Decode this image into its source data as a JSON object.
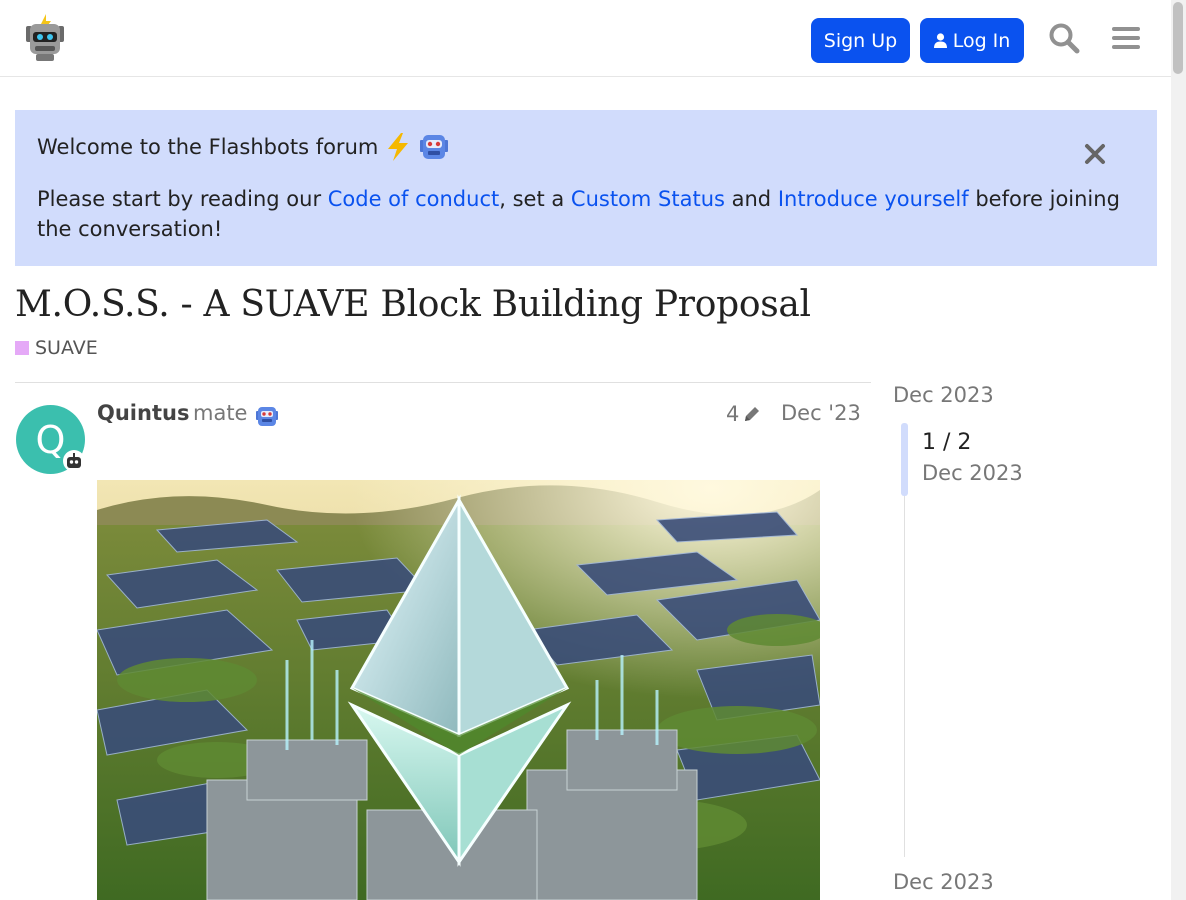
{
  "header": {
    "signup_label": "Sign Up",
    "login_label": "Log In",
    "icons": [
      "flashbots-robot-logo",
      "search-icon",
      "hamburger-menu-icon",
      "user-icon"
    ]
  },
  "banner": {
    "title": "Welcome to the Flashbots forum",
    "text_before": "Please start by reading our ",
    "link_conduct": "Code of conduct",
    "text_mid1": ", set a ",
    "link_status": "Custom Status",
    "text_mid2": " and ",
    "link_intro": "Introduce yourself",
    "text_after": " before joining the conversation!"
  },
  "topic": {
    "title": "M.O.S.S. - A SUAVE Block Building Proposal",
    "category": "SUAVE",
    "category_color": "#e5a9f7"
  },
  "post": {
    "avatar_letter": "Q",
    "avatar_color": "#3bbfae",
    "username": "Quintus",
    "user_title": "mate",
    "edit_count": "4",
    "date": "Dec '23"
  },
  "timeline": {
    "top_date": "Dec 2023",
    "position": "1 / 2",
    "current_date": "Dec 2023",
    "bottom_date": "Dec 2023"
  },
  "colors": {
    "accent": "#0a52ef",
    "banner_bg": "#d1dcfc"
  }
}
